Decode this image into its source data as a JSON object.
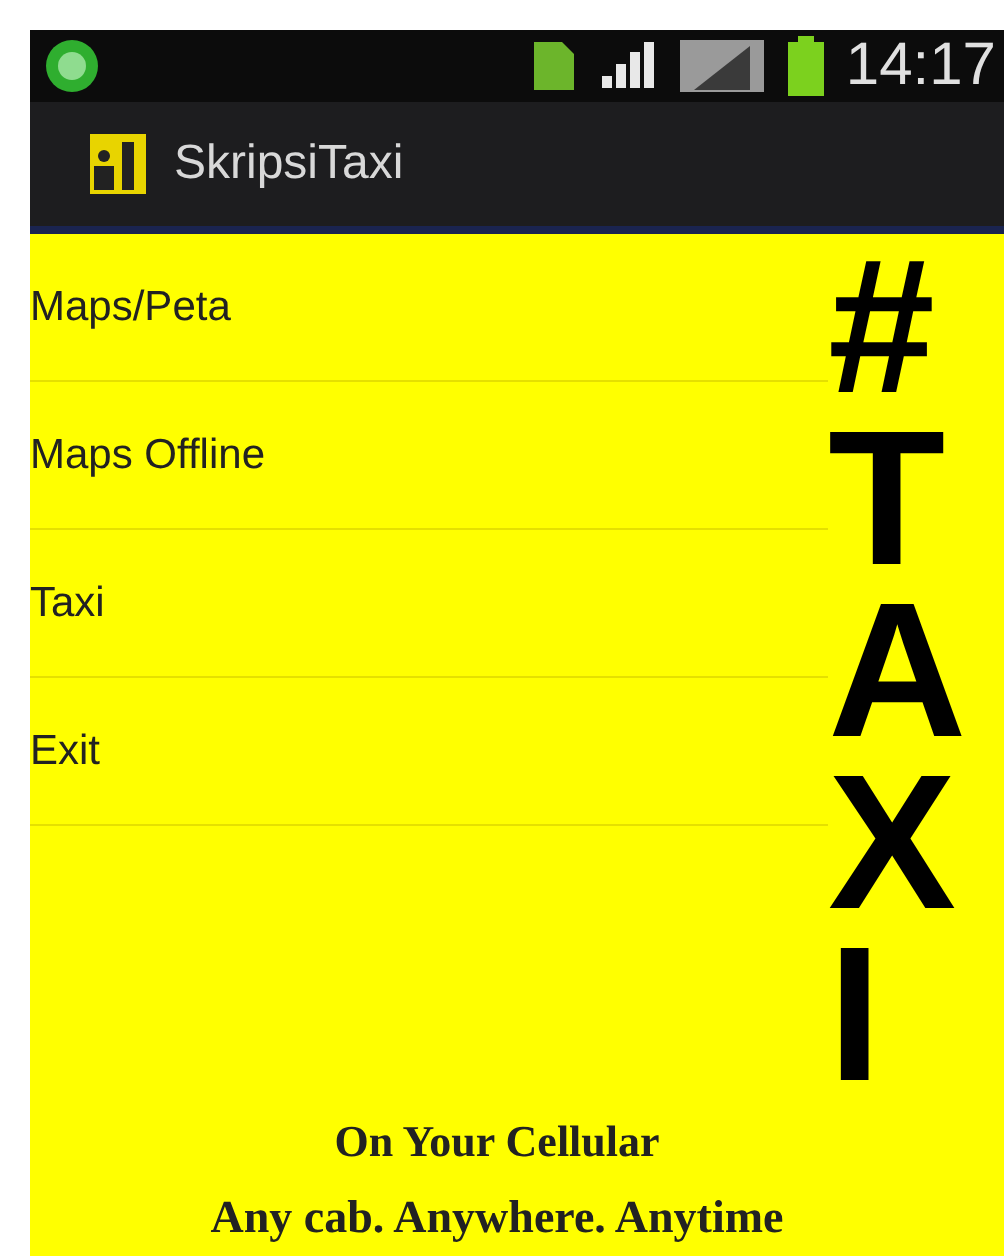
{
  "status_bar": {
    "time": "14:17"
  },
  "action_bar": {
    "title": "SkripsiTaxi"
  },
  "menu": [
    {
      "label": "Maps/Peta"
    },
    {
      "label": "Maps Offline"
    },
    {
      "label": "Taxi"
    },
    {
      "label": "Exit"
    }
  ],
  "banner": {
    "title": "#TAXI",
    "subtitle": "On Your Cellular",
    "slogan": "Any cab. Anywhere. Anytime"
  }
}
